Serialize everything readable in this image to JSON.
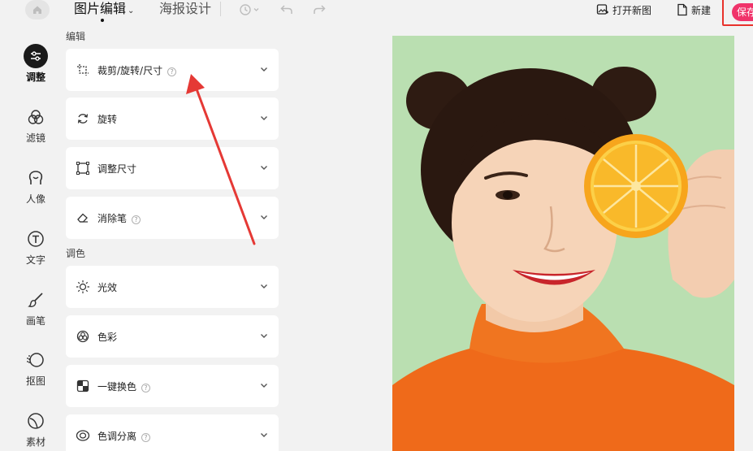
{
  "topbar": {
    "tab_edit": "图片编辑",
    "tab_poster": "海报设计",
    "open_image": "打开新图",
    "new": "新建",
    "save": "保存"
  },
  "rail": [
    {
      "label": "调整",
      "icon": "adjust-icon",
      "active": true
    },
    {
      "label": "滤镜",
      "icon": "filter-icon"
    },
    {
      "label": "人像",
      "icon": "portrait-icon"
    },
    {
      "label": "文字",
      "icon": "text-icon"
    },
    {
      "label": "画笔",
      "icon": "brush-icon"
    },
    {
      "label": "抠图",
      "icon": "cutout-icon"
    },
    {
      "label": "素材",
      "icon": "material-icon"
    }
  ],
  "panel": {
    "edit_section": "编辑",
    "color_section": "调色",
    "items": [
      {
        "label": "裁剪/旋转/尺寸",
        "icon": "crop-icon",
        "help": true
      },
      {
        "label": "旋转",
        "icon": "rotate-icon"
      },
      {
        "label": "调整尺寸",
        "icon": "resize-icon"
      },
      {
        "label": "消除笔",
        "icon": "eraser-icon",
        "help": true
      },
      {
        "label": "光效",
        "icon": "light-icon"
      },
      {
        "label": "色彩",
        "icon": "color-icon"
      },
      {
        "label": "一键换色",
        "icon": "swap-color-icon",
        "help": true
      },
      {
        "label": "色调分离",
        "icon": "split-tone-icon",
        "help": true
      }
    ]
  },
  "help_glyph": "?",
  "colors": {
    "accent": "#f0336a",
    "highlight_box": "#e8322b",
    "annotation_arrow": "#e53935",
    "photo_bg": "#b4dcab",
    "sweater": "#ef6a1a",
    "orange": "#f7a51c"
  }
}
